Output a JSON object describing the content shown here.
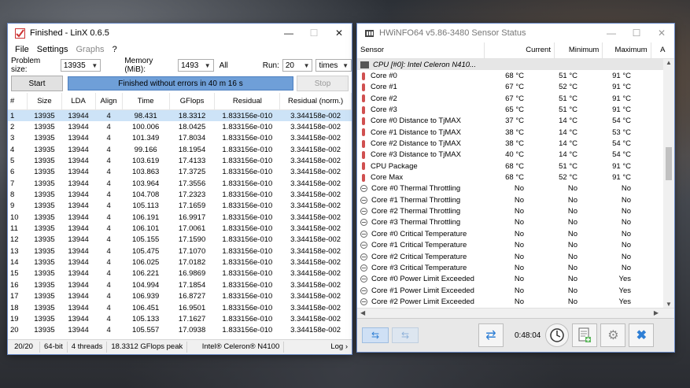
{
  "linx": {
    "title": "Finished - LinX 0.6.5",
    "menu": [
      "File",
      "Settings",
      "Graphs",
      "?"
    ],
    "problem_size_label": "Problem size:",
    "problem_size_value": "13935",
    "memory_label": "Memory (MiB):",
    "memory_value": "1493",
    "all_label": "All",
    "run_label": "Run:",
    "run_value": "20",
    "run_unit": "times",
    "start_label": "Start",
    "progress_text": "Finished without errors in 40 m 16 s",
    "stop_label": "Stop",
    "columns": [
      "#",
      "Size",
      "LDA",
      "Align",
      "Time",
      "GFlops",
      "Residual",
      "Residual (norm.)"
    ],
    "rows": [
      [
        "1",
        "13935",
        "13944",
        "4",
        "98.431",
        "18.3312",
        "1.833156e-010",
        "3.344158e-002"
      ],
      [
        "2",
        "13935",
        "13944",
        "4",
        "100.006",
        "18.0425",
        "1.833156e-010",
        "3.344158e-002"
      ],
      [
        "3",
        "13935",
        "13944",
        "4",
        "101.349",
        "17.8034",
        "1.833156e-010",
        "3.344158e-002"
      ],
      [
        "4",
        "13935",
        "13944",
        "4",
        "99.166",
        "18.1954",
        "1.833156e-010",
        "3.344158e-002"
      ],
      [
        "5",
        "13935",
        "13944",
        "4",
        "103.619",
        "17.4133",
        "1.833156e-010",
        "3.344158e-002"
      ],
      [
        "6",
        "13935",
        "13944",
        "4",
        "103.863",
        "17.3725",
        "1.833156e-010",
        "3.344158e-002"
      ],
      [
        "7",
        "13935",
        "13944",
        "4",
        "103.964",
        "17.3556",
        "1.833156e-010",
        "3.344158e-002"
      ],
      [
        "8",
        "13935",
        "13944",
        "4",
        "104.708",
        "17.2323",
        "1.833156e-010",
        "3.344158e-002"
      ],
      [
        "9",
        "13935",
        "13944",
        "4",
        "105.113",
        "17.1659",
        "1.833156e-010",
        "3.344158e-002"
      ],
      [
        "10",
        "13935",
        "13944",
        "4",
        "106.191",
        "16.9917",
        "1.833156e-010",
        "3.344158e-002"
      ],
      [
        "11",
        "13935",
        "13944",
        "4",
        "106.101",
        "17.0061",
        "1.833156e-010",
        "3.344158e-002"
      ],
      [
        "12",
        "13935",
        "13944",
        "4",
        "105.155",
        "17.1590",
        "1.833156e-010",
        "3.344158e-002"
      ],
      [
        "13",
        "13935",
        "13944",
        "4",
        "105.475",
        "17.1070",
        "1.833156e-010",
        "3.344158e-002"
      ],
      [
        "14",
        "13935",
        "13944",
        "4",
        "106.025",
        "17.0182",
        "1.833156e-010",
        "3.344158e-002"
      ],
      [
        "15",
        "13935",
        "13944",
        "4",
        "106.221",
        "16.9869",
        "1.833156e-010",
        "3.344158e-002"
      ],
      [
        "16",
        "13935",
        "13944",
        "4",
        "104.994",
        "17.1854",
        "1.833156e-010",
        "3.344158e-002"
      ],
      [
        "17",
        "13935",
        "13944",
        "4",
        "106.939",
        "16.8727",
        "1.833156e-010",
        "3.344158e-002"
      ],
      [
        "18",
        "13935",
        "13944",
        "4",
        "106.451",
        "16.9501",
        "1.833156e-010",
        "3.344158e-002"
      ],
      [
        "19",
        "13935",
        "13944",
        "4",
        "105.133",
        "17.1627",
        "1.833156e-010",
        "3.344158e-002"
      ],
      [
        "20",
        "13935",
        "13944",
        "4",
        "105.557",
        "17.0938",
        "1.833156e-010",
        "3.344158e-002"
      ]
    ],
    "status": [
      "20/20",
      "64-bit",
      "4 threads",
      "18.3312 GFlops peak",
      "Intel® Celeron® N4100",
      "Log ›"
    ]
  },
  "hwinfo": {
    "title": "HWiNFO64 v5.86-3480 Sensor Status",
    "columns": [
      "Sensor",
      "Current",
      "Minimum",
      "Maximum",
      "A"
    ],
    "group_label": "CPU [#0]: Intel Celeron N410...",
    "rows": [
      {
        "icon": "therm",
        "name": "Core #0",
        "cur": "68 °C",
        "min": "51 °C",
        "max": "91 °C"
      },
      {
        "icon": "therm",
        "name": "Core #1",
        "cur": "67 °C",
        "min": "52 °C",
        "max": "91 °C"
      },
      {
        "icon": "therm",
        "name": "Core #2",
        "cur": "67 °C",
        "min": "51 °C",
        "max": "91 °C"
      },
      {
        "icon": "therm",
        "name": "Core #3",
        "cur": "65 °C",
        "min": "51 °C",
        "max": "91 °C"
      },
      {
        "icon": "therm",
        "name": "Core #0 Distance to TjMAX",
        "cur": "37 °C",
        "min": "14 °C",
        "max": "54 °C"
      },
      {
        "icon": "therm",
        "name": "Core #1 Distance to TjMAX",
        "cur": "38 °C",
        "min": "14 °C",
        "max": "53 °C"
      },
      {
        "icon": "therm",
        "name": "Core #2 Distance to TjMAX",
        "cur": "38 °C",
        "min": "14 °C",
        "max": "54 °C"
      },
      {
        "icon": "therm",
        "name": "Core #3 Distance to TjMAX",
        "cur": "40 °C",
        "min": "14 °C",
        "max": "54 °C"
      },
      {
        "icon": "therm",
        "name": "CPU Package",
        "cur": "68 °C",
        "min": "51 °C",
        "max": "91 °C"
      },
      {
        "icon": "therm",
        "name": "Core Max",
        "cur": "68 °C",
        "min": "52 °C",
        "max": "91 °C"
      },
      {
        "icon": "circ",
        "name": "Core #0 Thermal Throttling",
        "cur": "No",
        "min": "No",
        "max": "No"
      },
      {
        "icon": "circ",
        "name": "Core #1 Thermal Throttling",
        "cur": "No",
        "min": "No",
        "max": "No"
      },
      {
        "icon": "circ",
        "name": "Core #2 Thermal Throttling",
        "cur": "No",
        "min": "No",
        "max": "No"
      },
      {
        "icon": "circ",
        "name": "Core #3 Thermal Throttling",
        "cur": "No",
        "min": "No",
        "max": "No"
      },
      {
        "icon": "circ",
        "name": "Core #0 Critical Temperature",
        "cur": "No",
        "min": "No",
        "max": "No"
      },
      {
        "icon": "circ",
        "name": "Core #1 Critical Temperature",
        "cur": "No",
        "min": "No",
        "max": "No"
      },
      {
        "icon": "circ",
        "name": "Core #2 Critical Temperature",
        "cur": "No",
        "min": "No",
        "max": "No"
      },
      {
        "icon": "circ",
        "name": "Core #3 Critical Temperature",
        "cur": "No",
        "min": "No",
        "max": "No"
      },
      {
        "icon": "circ",
        "name": "Core #0 Power Limit Exceeded",
        "cur": "No",
        "min": "No",
        "max": "Yes"
      },
      {
        "icon": "circ",
        "name": "Core #1 Power Limit Exceeded",
        "cur": "No",
        "min": "No",
        "max": "Yes"
      },
      {
        "icon": "circ",
        "name": "Core #2 Power Limit Exceeded",
        "cur": "No",
        "min": "No",
        "max": "Yes"
      }
    ],
    "timer": "0:48:04",
    "colors": {
      "accent": "#2f7fd5",
      "progress": "#6f9fd8",
      "select": "#cde3f7",
      "therm": "#d05050"
    }
  }
}
